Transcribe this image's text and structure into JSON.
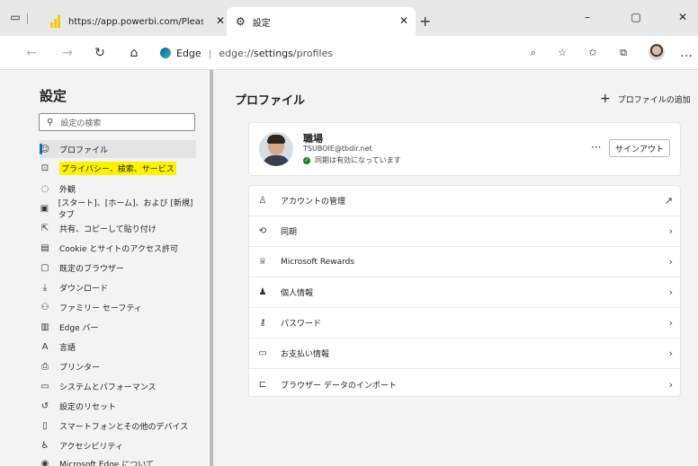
{
  "tabs": [
    {
      "title": "https://app.powerbi.com/PleaseV",
      "close": "✕"
    },
    {
      "title": "設定",
      "close": "✕"
    }
  ],
  "new_tab": "+",
  "window": {
    "minimize": "–",
    "maximize": "▢",
    "close": "✕"
  },
  "address": {
    "site": "Edge",
    "separator": "|",
    "url_prefix": "edge://",
    "url_bold": "settings",
    "url_suffix": "/profiles"
  },
  "sidebar": {
    "title": "設定",
    "search_placeholder": "設定の検索",
    "items": [
      {
        "label": "プロファイル",
        "icon": "profile-icon"
      },
      {
        "label": "プライバシー、検索、サービス",
        "icon": "lock-icon"
      },
      {
        "label": "外観",
        "icon": "appearance-icon"
      },
      {
        "label": "[スタート]、[ホーム]、および [新規] タブ",
        "icon": "home-tab-icon"
      },
      {
        "label": "共有、コピーして貼り付け",
        "icon": "share-icon"
      },
      {
        "label": "Cookie とサイトのアクセス許可",
        "icon": "cookie-icon"
      },
      {
        "label": "既定のブラウザー",
        "icon": "browser-icon"
      },
      {
        "label": "ダウンロード",
        "icon": "download-icon"
      },
      {
        "label": "ファミリー セーフティ",
        "icon": "family-icon"
      },
      {
        "label": "Edge バー",
        "icon": "edge-bar-icon"
      },
      {
        "label": "言語",
        "icon": "language-icon"
      },
      {
        "label": "プリンター",
        "icon": "printer-icon"
      },
      {
        "label": "システムとパフォーマンス",
        "icon": "system-icon"
      },
      {
        "label": "設定のリセット",
        "icon": "reset-icon"
      },
      {
        "label": "スマートフォンとその他のデバイス",
        "icon": "phone-icon"
      },
      {
        "label": "アクセシビリティ",
        "icon": "accessibility-icon"
      },
      {
        "label": "Microsoft Edge について",
        "icon": "edge-about-icon"
      }
    ]
  },
  "main": {
    "title": "プロファイル",
    "add_profile": "プロファイルの追加",
    "profile": {
      "name": "職場",
      "email": "TSUBOIE@tbdir.net",
      "sync_status": "同期は有効になっています",
      "more": "···",
      "signout": "サインアウト"
    },
    "rows": [
      {
        "label": "アカウントの管理",
        "icon": "account-icon",
        "trail": "external-link-icon"
      },
      {
        "label": "同期",
        "icon": "sync-icon",
        "trail": "chevron-right-icon"
      },
      {
        "label": "Microsoft Rewards",
        "icon": "rewards-icon",
        "trail": "chevron-right-icon"
      },
      {
        "label": "個人情報",
        "icon": "personal-info-icon",
        "trail": "chevron-right-icon"
      },
      {
        "label": "パスワード",
        "icon": "key-icon",
        "trail": "chevron-right-icon"
      },
      {
        "label": "お支払い情報",
        "icon": "card-icon",
        "trail": "chevron-right-icon"
      },
      {
        "label": "ブラウザー データのインポート",
        "icon": "import-icon",
        "trail": "chevron-right-icon"
      }
    ]
  },
  "colors": {
    "accent": "#0f6cbd",
    "highlight": "#fff200",
    "sync_ok": "#0e8a16"
  }
}
